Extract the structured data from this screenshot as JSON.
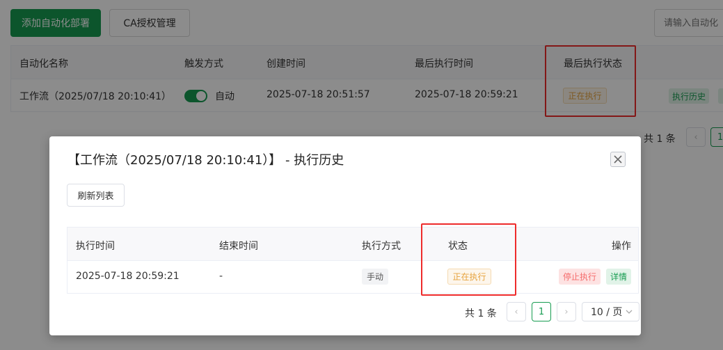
{
  "toolbar": {
    "add_label": "添加自动化部署",
    "ca_label": "CA授权管理",
    "search_placeholder": "请输入自动化"
  },
  "main_table": {
    "headers": [
      "自动化名称",
      "触发方式",
      "创建时间",
      "最后执行时间",
      "最后执行状态"
    ],
    "row": {
      "name": "工作流（2025/07/18 20:10:41）",
      "trigger_enabled": true,
      "trigger_label": "自动",
      "created": "2025-07-18 20:51:57",
      "last_run": "2025-07-18 20:59:21",
      "status": "正在执行",
      "action_history": "执行历史"
    }
  },
  "main_pagination": {
    "total": "共 1 条",
    "current_page": "1"
  },
  "dialog": {
    "title": "【工作流（2025/07/18 20:10:41）】 - 执行历史",
    "refresh_label": "刷新列表",
    "headers": [
      "执行时间",
      "结束时间",
      "执行方式",
      "状态",
      "操作"
    ],
    "row": {
      "start": "2025-07-18 20:59:21",
      "end": "-",
      "mode": "手动",
      "status": "正在执行",
      "stop_label": "停止执行",
      "detail_label": "详情"
    },
    "pagination": {
      "total": "共 1 条",
      "current_page": "1",
      "page_size": "10 / 页"
    }
  },
  "colors": {
    "primary": "#179c51",
    "warning": "#e6a23c",
    "danger": "#f56c6c",
    "highlight_box": "#ee2b2b"
  }
}
